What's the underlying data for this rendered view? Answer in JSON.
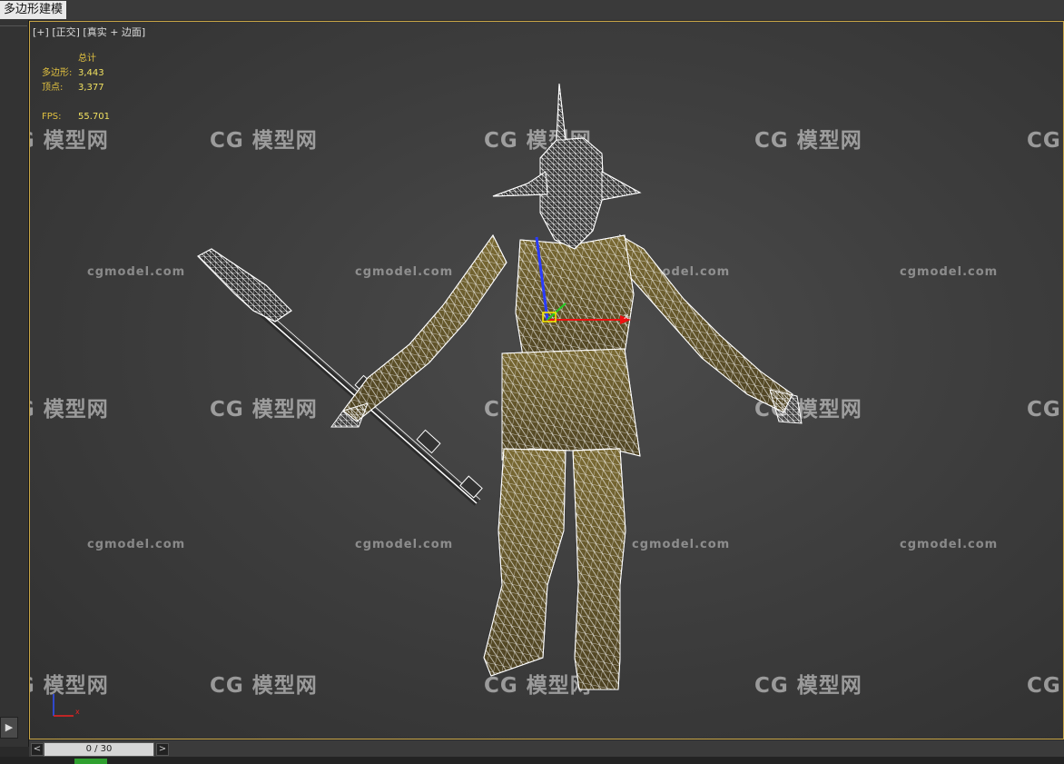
{
  "window": {
    "ribbon_label": "多边形建模"
  },
  "viewport": {
    "label_plus": "[+]",
    "label_view": "[正交]",
    "label_shading": "[真实 + 边面]",
    "stats": {
      "header": "总计",
      "polys_label": "多边形:",
      "polys_value": "3,443",
      "verts_label": "顶点:",
      "verts_value": "3,377",
      "fps_label": "FPS:",
      "fps_value": "55.701"
    },
    "gizmo_axis_x": "x",
    "axis_tripod_x": "x"
  },
  "watermarks": {
    "cn": "CG 模型网",
    "en": "cgmodel.com"
  },
  "timeline": {
    "frame": "0 / 30",
    "prev": "<",
    "next": ">"
  },
  "left_panel": {
    "play_icon": "▶"
  },
  "colors": {
    "viewport_border": "#c9a646",
    "stats_text": "#e0c040",
    "wire": "#ffffff",
    "skin": "#6b5a2a"
  }
}
